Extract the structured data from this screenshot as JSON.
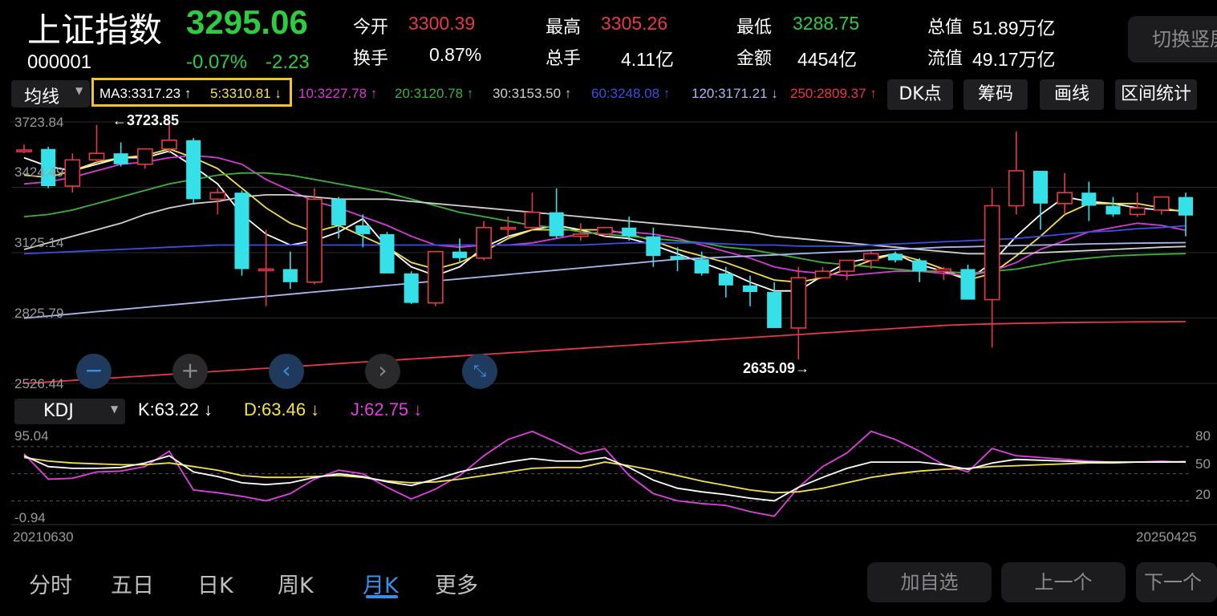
{
  "header": {
    "name": "上证指数",
    "price": "3295.06",
    "code": "000001",
    "change_pct": "-0.07%",
    "change_abs": "-2.23",
    "stats": [
      {
        "label": "今开",
        "value": "3300.39",
        "color": "red"
      },
      {
        "label": "最高",
        "value": "3305.26",
        "color": "red"
      },
      {
        "label": "最低",
        "value": "3288.75",
        "color": "green"
      },
      {
        "label": "总值",
        "value": "51.89万亿",
        "color": "white"
      },
      {
        "label": "换手",
        "value": "0.87%",
        "color": "white"
      },
      {
        "label": "总手",
        "value": "4.11亿",
        "color": "white"
      },
      {
        "label": "金额",
        "value": "4454亿",
        "color": "white"
      },
      {
        "label": "流值",
        "value": "49.17万亿",
        "color": "white"
      }
    ],
    "switch_button": "切换竖屏"
  },
  "ma_bar": {
    "selector": "均线",
    "items": [
      {
        "text": "MA3:3317.23 ↑",
        "color": "#ffffff"
      },
      {
        "text": "5:3310.81 ↓",
        "color": "#f5e050"
      },
      {
        "text": "10:3227.78 ↑",
        "color": "#d63bd6"
      },
      {
        "text": "20:3120.78 ↑",
        "color": "#3bb33b"
      },
      {
        "text": "30:3153.50 ↑",
        "color": "#d0d0d0"
      },
      {
        "text": "60:3248.08 ↑",
        "color": "#3b4fe0"
      },
      {
        "text": "120:3171.21 ↓",
        "color": "#a9b8f0"
      },
      {
        "text": "250:2809.37 ↑",
        "color": "#e63946"
      }
    ],
    "tools": [
      "DK点",
      "筹码",
      "画线",
      "区间统计"
    ]
  },
  "price_axis": [
    "3723.84",
    "3424.49",
    "3125.14",
    "2825.79",
    "2526.44"
  ],
  "annotations": {
    "high": "←3723.85",
    "low": "2635.09→"
  },
  "kdj": {
    "selector": "KDJ",
    "k": "K:63.22 ↓",
    "d": "D:63.46 ↓",
    "j": "J:62.75 ↓",
    "axis_left": [
      "95.04",
      "-0.94"
    ],
    "axis_right": [
      "80",
      "50",
      "20"
    ]
  },
  "dates": {
    "start": "20210630",
    "end": "20250425"
  },
  "tabs": [
    {
      "label": "分时",
      "active": false
    },
    {
      "label": "五日",
      "active": false
    },
    {
      "label": "日K",
      "active": false
    },
    {
      "label": "周K",
      "active": false
    },
    {
      "label": "月K",
      "active": true
    },
    {
      "label": "更多",
      "active": false
    }
  ],
  "bottom_buttons": [
    "加自选",
    "上一个",
    "下一个"
  ],
  "chart_data": {
    "type": "candlestick",
    "period": "monthly",
    "ylim": [
      2526.44,
      3723.84
    ],
    "candles": [
      [
        3590,
        3620,
        3580,
        3595
      ],
      [
        3600,
        3610,
        3420,
        3430
      ],
      [
        3430,
        3580,
        3400,
        3550
      ],
      [
        3550,
        3710,
        3540,
        3580
      ],
      [
        3580,
        3630,
        3520,
        3530
      ],
      [
        3530,
        3600,
        3510,
        3600
      ],
      [
        3600,
        3723.85,
        3580,
        3640
      ],
      [
        3640,
        3650,
        3350,
        3370
      ],
      [
        3370,
        3420,
        3300,
        3400
      ],
      [
        3400,
        3410,
        3020,
        3050
      ],
      [
        3050,
        3230,
        2880,
        3050
      ],
      [
        3050,
        3130,
        2960,
        2990
      ],
      [
        2990,
        3420,
        2980,
        3370
      ],
      [
        3370,
        3380,
        3190,
        3250
      ],
      [
        3250,
        3300,
        3150,
        3210
      ],
      [
        3210,
        3220,
        3050,
        3030
      ],
      [
        3030,
        3040,
        2890,
        2895
      ],
      [
        2895,
        3130,
        2880,
        3130
      ],
      [
        3130,
        3190,
        3080,
        3100
      ],
      [
        3100,
        3270,
        3090,
        3240
      ],
      [
        3240,
        3290,
        3200,
        3240
      ],
      [
        3240,
        3400,
        3230,
        3310
      ],
      [
        3310,
        3420,
        3190,
        3200
      ],
      [
        3200,
        3260,
        3180,
        3210
      ],
      [
        3210,
        3240,
        3200,
        3240
      ],
      [
        3240,
        3290,
        3180,
        3200
      ],
      [
        3200,
        3240,
        3060,
        3110
      ],
      [
        3110,
        3150,
        3040,
        3095
      ],
      [
        3095,
        3130,
        3020,
        3030
      ],
      [
        3030,
        3060,
        2920,
        2975
      ],
      [
        2975,
        3020,
        2880,
        2945
      ],
      [
        2945,
        2990,
        2800,
        2780
      ],
      [
        2780,
        3060,
        2635.09,
        3010
      ],
      [
        3010,
        3060,
        3030,
        3040
      ],
      [
        3040,
        3090,
        3000,
        3090
      ],
      [
        3090,
        3130,
        3050,
        3120
      ],
      [
        3120,
        3130,
        3080,
        3090
      ],
      [
        3090,
        3100,
        2990,
        3040
      ],
      [
        3040,
        3060,
        3000,
        3050
      ],
      [
        3050,
        3070,
        2950,
        2910
      ],
      [
        2910,
        3420,
        2690,
        3340
      ],
      [
        3340,
        3680,
        3300,
        3500
      ],
      [
        3500,
        3450,
        3230,
        3350
      ],
      [
        3350,
        3490,
        3300,
        3400
      ],
      [
        3400,
        3450,
        3270,
        3340
      ],
      [
        3340,
        3380,
        3290,
        3300
      ],
      [
        3300,
        3400,
        3290,
        3330
      ],
      [
        3320,
        3380,
        3300,
        3380
      ],
      [
        3380,
        3400,
        3200,
        3295
      ]
    ],
    "ma": {
      "MA3": [
        3560,
        3520,
        3500,
        3530,
        3560,
        3560,
        3590,
        3520,
        3440,
        3300,
        3210,
        3160,
        3180,
        3220,
        3280,
        3150,
        3060,
        3020,
        3060,
        3150,
        3200,
        3230,
        3250,
        3230,
        3200,
        3190,
        3160,
        3120,
        3080,
        3040,
        2990,
        2950,
        2950,
        3020,
        3080,
        3100,
        3120,
        3070,
        3040,
        3000,
        3080,
        3200,
        3300,
        3380,
        3360,
        3350,
        3330,
        3320,
        3317.23
      ],
      "MA5": [
        3480,
        3470,
        3500,
        3540,
        3560,
        3570,
        3600,
        3560,
        3510,
        3420,
        3330,
        3260,
        3220,
        3250,
        3200,
        3150,
        3080,
        3050,
        3080,
        3130,
        3190,
        3230,
        3230,
        3230,
        3230,
        3210,
        3180,
        3140,
        3110,
        3080,
        3040,
        3000,
        2990,
        3010,
        3050,
        3090,
        3120,
        3090,
        3050,
        3000,
        3030,
        3110,
        3200,
        3300,
        3350,
        3350,
        3350,
        3330,
        3310.81
      ],
      "MA10": [
        3440,
        3450,
        3470,
        3500,
        3530,
        3540,
        3560,
        3570,
        3560,
        3530,
        3460,
        3410,
        3360,
        3330,
        3290,
        3250,
        3200,
        3160,
        3150,
        3160,
        3160,
        3170,
        3190,
        3210,
        3220,
        3220,
        3210,
        3190,
        3160,
        3130,
        3100,
        3060,
        3040,
        3030,
        3020,
        3030,
        3040,
        3040,
        3030,
        3020,
        3040,
        3080,
        3140,
        3180,
        3220,
        3240,
        3260,
        3250,
        3227.78
      ],
      "MA20": [
        3290,
        3300,
        3320,
        3350,
        3380,
        3410,
        3440,
        3460,
        3480,
        3490,
        3490,
        3480,
        3460,
        3440,
        3420,
        3400,
        3370,
        3340,
        3310,
        3290,
        3270,
        3250,
        3240,
        3220,
        3210,
        3200,
        3190,
        3180,
        3170,
        3150,
        3140,
        3120,
        3100,
        3080,
        3070,
        3060,
        3050,
        3040,
        3040,
        3030,
        3040,
        3050,
        3070,
        3090,
        3100,
        3110,
        3115,
        3118,
        3120.78
      ],
      "MA30": [
        3140,
        3170,
        3200,
        3230,
        3260,
        3300,
        3330,
        3350,
        3360,
        3380,
        3390,
        3390,
        3380,
        3370,
        3370,
        3370,
        3360,
        3350,
        3340,
        3330,
        3320,
        3310,
        3300,
        3290,
        3280,
        3270,
        3260,
        3250,
        3240,
        3230,
        3220,
        3200,
        3190,
        3180,
        3170,
        3160,
        3150,
        3140,
        3130,
        3120,
        3120,
        3120,
        3125,
        3130,
        3135,
        3140,
        3145,
        3150,
        3153.5
      ],
      "MA60": [
        3120,
        3125,
        3130,
        3135,
        3140,
        3145,
        3150,
        3155,
        3160,
        3160,
        3160,
        3160,
        3160,
        3160,
        3160,
        3160,
        3160,
        3160,
        3160,
        3160,
        3160,
        3160,
        3160,
        3160,
        3165,
        3170,
        3170,
        3170,
        3170,
        3165,
        3160,
        3160,
        3155,
        3155,
        3155,
        3160,
        3165,
        3170,
        3175,
        3180,
        3185,
        3190,
        3200,
        3210,
        3220,
        3225,
        3235,
        3240,
        3248.08
      ],
      "MA120": [
        2825,
        2835,
        2845,
        2855,
        2865,
        2875,
        2885,
        2895,
        2905,
        2915,
        2925,
        2935,
        2945,
        2955,
        2965,
        2975,
        2985,
        2995,
        3005,
        3015,
        3025,
        3035,
        3045,
        3055,
        3065,
        3075,
        3085,
        3095,
        3100,
        3105,
        3110,
        3115,
        3120,
        3125,
        3130,
        3135,
        3140,
        3145,
        3150,
        3152,
        3155,
        3158,
        3160,
        3162,
        3165,
        3167,
        3169,
        3170,
        3171.21
      ],
      "MA250": [
        2526.44,
        2533,
        2540,
        2547,
        2554,
        2561,
        2568,
        2575,
        2582,
        2589,
        2596,
        2603,
        2610,
        2617,
        2624,
        2631,
        2638,
        2645,
        2652,
        2659,
        2666,
        2673,
        2680,
        2687,
        2694,
        2701,
        2708,
        2715,
        2722,
        2729,
        2736,
        2743,
        2750,
        2757,
        2764,
        2771,
        2778,
        2785,
        2792,
        2796,
        2799,
        2801,
        2803,
        2805,
        2806,
        2807,
        2808,
        2808.5,
        2809.37
      ]
    },
    "kdj_ylim": [
      -0.94,
      95.04
    ],
    "K": [
      70,
      58,
      56,
      56,
      57,
      62,
      70,
      52,
      47,
      40,
      38,
      40,
      46,
      50,
      47,
      41,
      37,
      44,
      52,
      58,
      63,
      67,
      64,
      64,
      68,
      57,
      43,
      34,
      30,
      27,
      23,
      20,
      35,
      46,
      56,
      63,
      63,
      63,
      60,
      55,
      62,
      66,
      65,
      64,
      63,
      63,
      63,
      63,
      63.22
    ],
    "D": [
      68,
      64,
      62,
      61,
      60,
      60,
      62,
      58,
      54,
      48,
      46,
      46,
      47,
      48,
      46,
      42,
      40,
      41,
      44,
      48,
      52,
      56,
      57,
      57,
      63,
      59,
      54,
      48,
      42,
      37,
      32,
      29,
      30,
      34,
      40,
      46,
      50,
      53,
      55,
      56,
      58,
      59,
      60,
      61,
      62,
      62,
      63,
      63,
      63.46
    ],
    "J": [
      72,
      44,
      45,
      52,
      53,
      58,
      75,
      32,
      29,
      25,
      20,
      28,
      44,
      54,
      50,
      35,
      22,
      33,
      48,
      70,
      88,
      97,
      85,
      72,
      78,
      48,
      28,
      20,
      17,
      15,
      8,
      3,
      35,
      58,
      73,
      97,
      88,
      75,
      60,
      52,
      78,
      70,
      68,
      66,
      64,
      63,
      63,
      64,
      62.75
    ]
  }
}
